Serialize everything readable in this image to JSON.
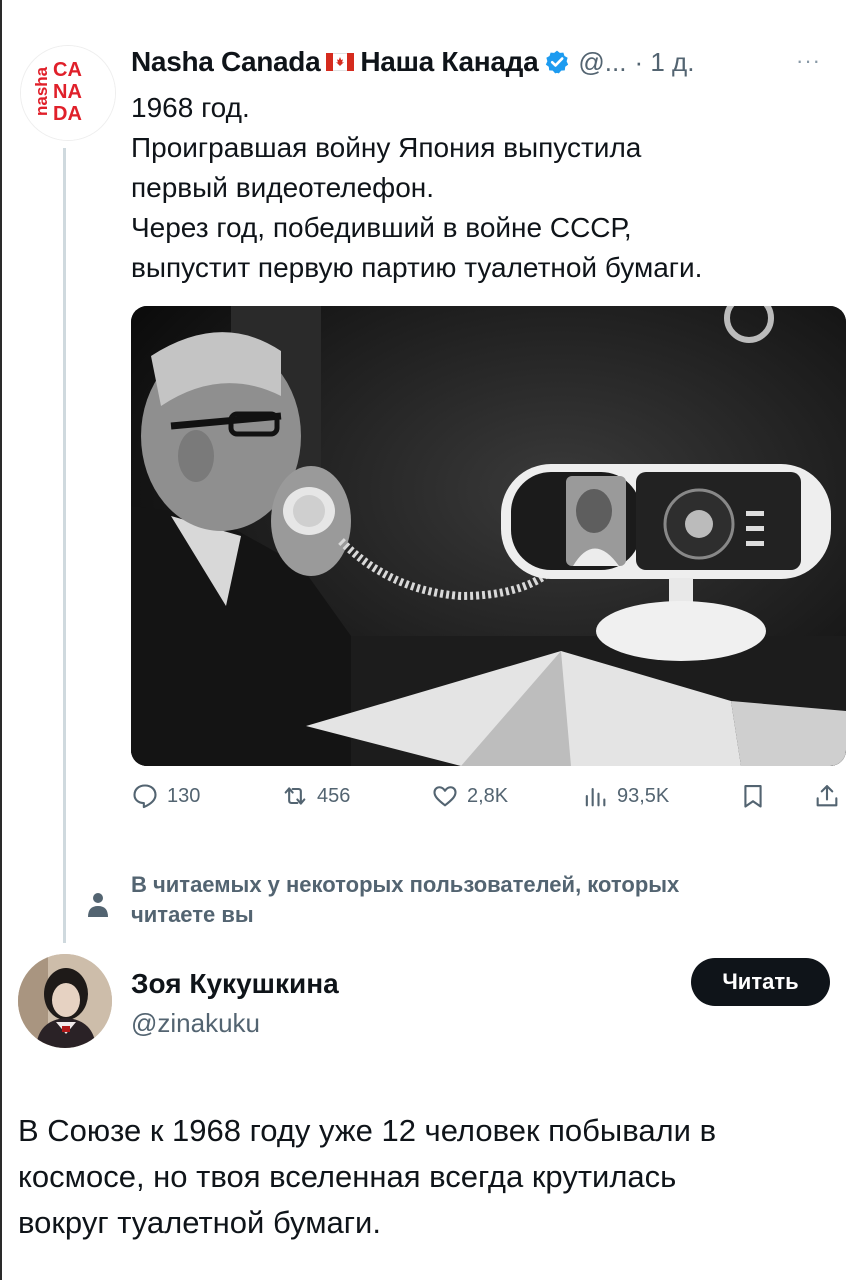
{
  "tweet": {
    "author_name": "Nasha Canada",
    "author_name_ru": "Наша Канада",
    "handle": "@...",
    "time": "· 1 д.",
    "more": "···",
    "avatar_text": "nasha CA NA DA",
    "lines": [
      "1968 год.",
      "Проигравшая войну Япония выпустила",
      "первый видеотелефон.",
      "Через год, победивший в войне СССР,",
      "выпустит первую партию туалетной бумаги."
    ],
    "stats": {
      "replies": "130",
      "reposts": "456",
      "likes": "2,8K",
      "views": "93,5K"
    },
    "icons": [
      "reply-icon",
      "repost-icon",
      "like-icon",
      "views-icon",
      "bookmark-icon",
      "share-icon"
    ]
  },
  "social_context": {
    "line1": "В читаемых у некоторых пользователей, которых",
    "line2": "читаете вы"
  },
  "profile": {
    "name": "Зоя Кукушкина",
    "handle": "@zinakuku",
    "follow_label": "Читать",
    "bio_lines": [
      "В Союзе к 1968 году уже 12 человек побывали в",
      "космосе, но твоя вселенная всегда крутилась",
      "вокруг туалетной бумаги."
    ]
  },
  "colors": {
    "text": "#0f1419",
    "secondary": "#536471",
    "verified": "#1d9bf0",
    "button": "#0f1419",
    "logo_red": "#e0202a"
  }
}
